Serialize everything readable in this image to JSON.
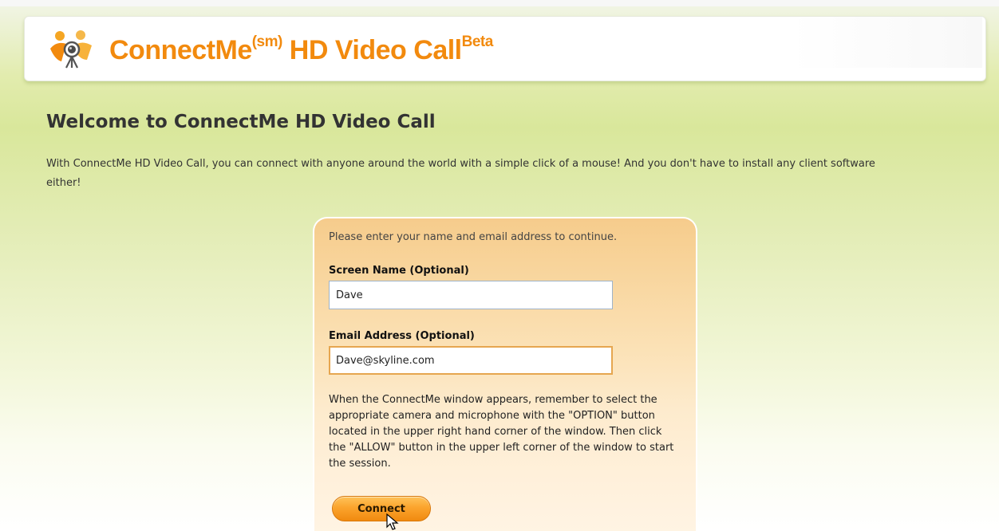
{
  "header": {
    "brand": "ConnectMe",
    "brand_sup": "(sm)",
    "brand_rest": " HD Video Call",
    "beta": "Beta",
    "brand_color": "#f28a0e",
    "logo_icon": "people-webcam-logo-icon"
  },
  "welcome": {
    "title": "Welcome to ConnectMe HD Video Call",
    "intro": "With ConnectMe HD Video Call, you can connect with anyone around the world with a simple click of a mouse! And you don't have to install any client software either!"
  },
  "form": {
    "prompt": "Please enter your name and email address to continue.",
    "screen_name_label": "Screen Name (Optional)",
    "screen_name_value": "Dave",
    "email_label": "Email Address (Optional)",
    "email_value": "Dave@skyline.com",
    "note": "When the ConnectMe window appears, remember to select the appropriate camera and microphone with the \"OPTION\" button located in the upper right hand corner of the window. Then click the \"ALLOW\" button in the upper left corner of the window to start the session.",
    "connect_label": "Connect",
    "button_color": "#fba42d"
  }
}
